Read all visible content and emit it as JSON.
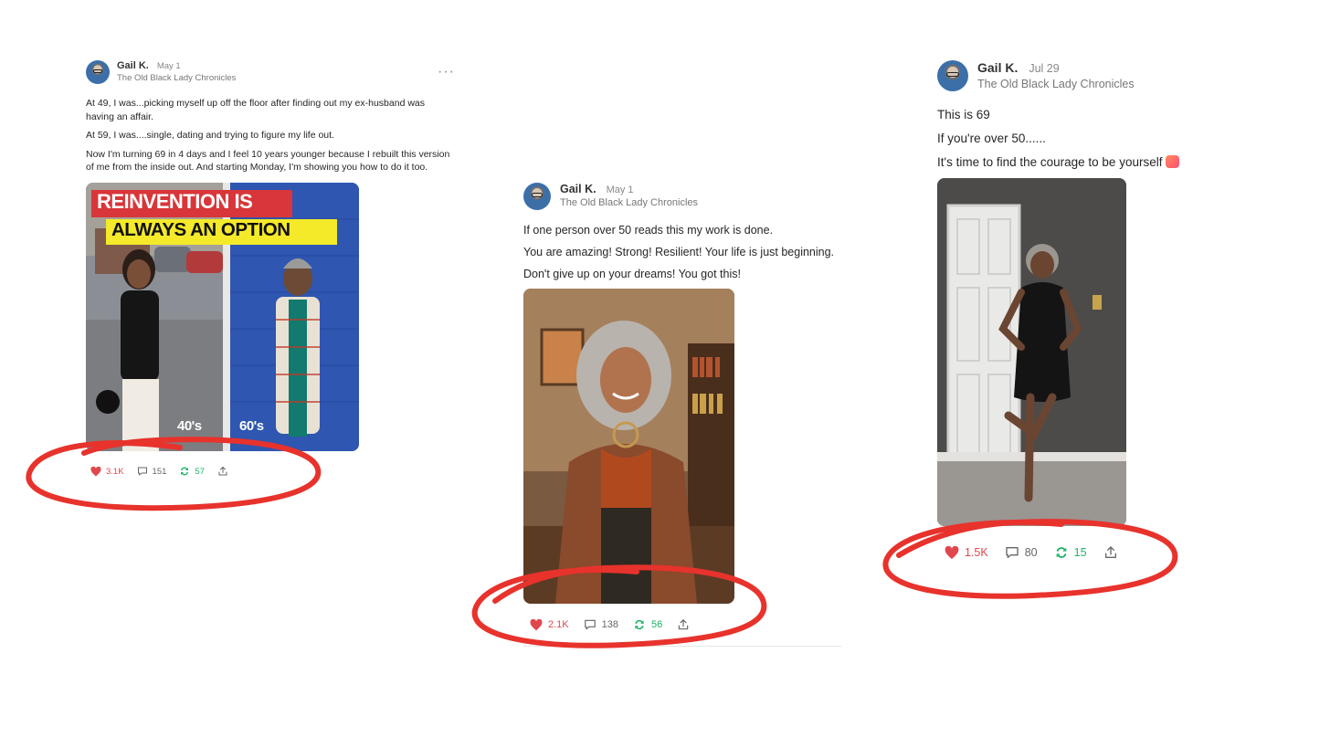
{
  "colors": {
    "like": "#e0474c",
    "restack": "#1fb36b",
    "annotation": "#e8322c"
  },
  "posts": [
    {
      "author": "Gail K.",
      "date": "May 1",
      "publication": "The Old Black Lady Chronicles",
      "more": "···",
      "paragraphs": [
        "At 49, I was...picking myself up off the floor after finding out my ex-husband was having an affair.",
        "At 59, I was....single, dating and trying to figure my life out.",
        "Now I'm turning 69 in 4 days and I feel 10 years younger because I rebuilt this version of me from the inside out. And starting Monday, I'm showing you how to do it too."
      ],
      "image": {
        "headline_line1": "REINVENTION IS",
        "headline_line2": "ALWAYS AN OPTION",
        "left_label": "40's",
        "right_label": "60's"
      },
      "likes": "3.1K",
      "comments": "151",
      "restacks": "57"
    },
    {
      "author": "Gail K.",
      "date": "May 1",
      "publication": "The Old Black Lady Chronicles",
      "paragraphs": [
        "If one person over 50 reads this my work is done.",
        "You are amazing! Strong! Resilient! Your life is just beginning.",
        "Don't give up on your dreams! You got this!"
      ],
      "likes": "2.1K",
      "comments": "138",
      "restacks": "56"
    },
    {
      "author": "Gail K.",
      "date": "Jul 29",
      "publication": "The Old Black Lady Chronicles",
      "paragraphs": [
        "This is 69",
        "If you're over 50......",
        "It's time to find the courage to be yourself"
      ],
      "likes": "1.5K",
      "comments": "80",
      "restacks": "15"
    }
  ]
}
